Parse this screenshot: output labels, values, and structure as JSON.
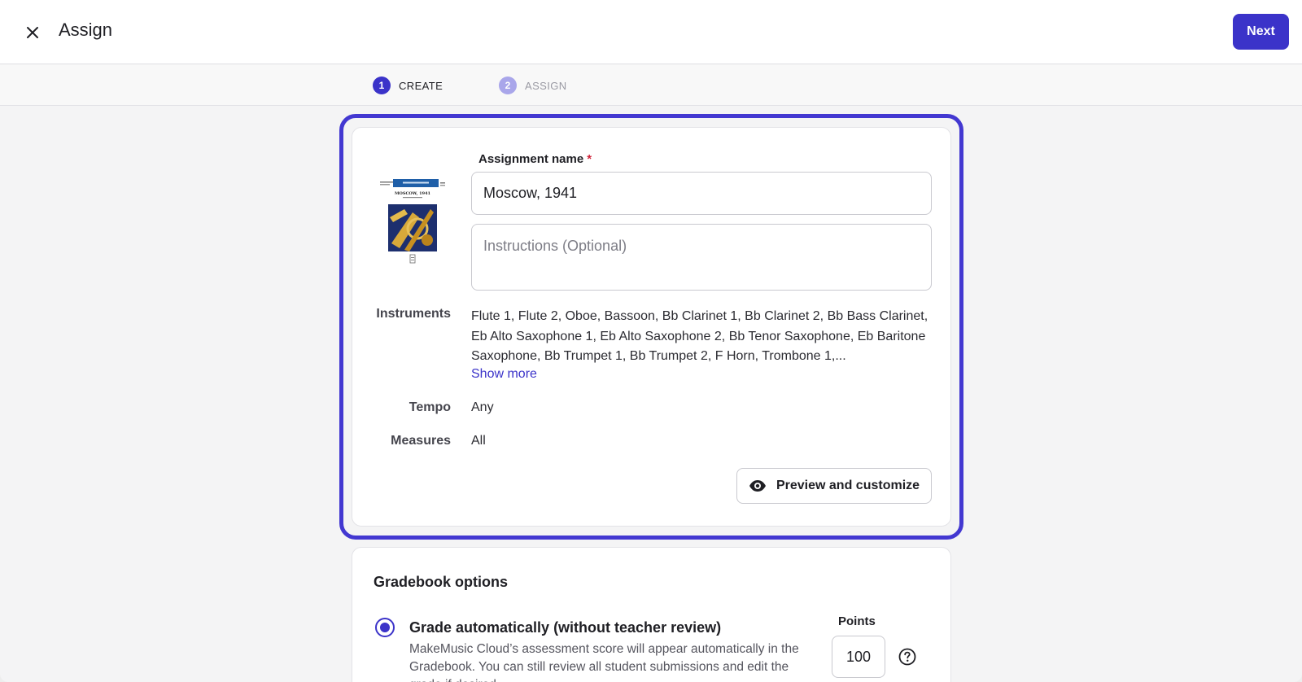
{
  "header": {
    "title": "Assign",
    "next_label": "Next"
  },
  "stepper": {
    "steps": [
      {
        "number": "1",
        "label": "CREATE"
      },
      {
        "number": "2",
        "label": "ASSIGN"
      }
    ]
  },
  "assignment": {
    "name_label": "Assignment name",
    "required_mark": "*",
    "name_value": "Moscow, 1941",
    "instructions_placeholder": "Instructions (Optional)",
    "cover_title": "MOSCOW, 1941",
    "instruments_label": "Instruments",
    "instruments_value": "Flute 1, Flute 2, Oboe, Bassoon, Bb Clarinet 1, Bb Clarinet 2, Bb Bass Clarinet, Eb Alto Saxophone 1, Eb Alto Saxophone 2, Bb Tenor Saxophone, Eb Baritone Saxophone, Bb Trumpet 1, Bb Trumpet 2, F Horn, Trombone 1,...",
    "show_more_label": "Show more",
    "tempo_label": "Tempo",
    "tempo_value": "Any",
    "measures_label": "Measures",
    "measures_value": "All",
    "preview_label": "Preview and customize"
  },
  "gradebook": {
    "title": "Gradebook options",
    "option_title": "Grade automatically (without teacher review)",
    "option_desc": "MakeMusic Cloud’s assessment score will appear automatically in the Gradebook. You can still review all student submissions and edit the grade if desired.",
    "points_label": "Points",
    "points_value": "100"
  },
  "colors": {
    "accent": "#3b33c9",
    "required": "#d0233a"
  }
}
